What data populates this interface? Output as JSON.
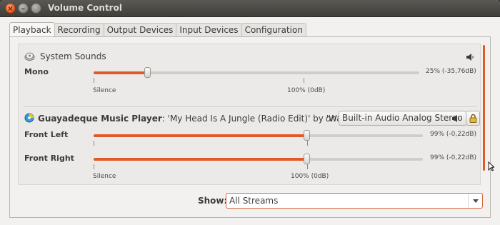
{
  "window": {
    "title": "Volume Control"
  },
  "tabs": [
    {
      "label": "Playback",
      "active": true
    },
    {
      "label": "Recording",
      "active": false
    },
    {
      "label": "Output Devices",
      "active": false
    },
    {
      "label": "Input Devices",
      "active": false
    },
    {
      "label": "Configuration",
      "active": false
    }
  ],
  "streams": {
    "system": {
      "name": "System Sounds",
      "icon": "system-sounds-icon",
      "channels": [
        {
          "label": "Mono",
          "level": 0.25,
          "readout": "25% (-35,76dB)"
        }
      ],
      "scale_labels": {
        "silence": "Silence",
        "full": "100% (0dB)"
      }
    },
    "player": {
      "app": "Guayadeque Music Player",
      "separator": ":",
      "description": "'My Head Is A Jungle (Radio Edit)' by 'Wankelmut'",
      "on_label": "on",
      "device": "Built-in Audio Analog Stereo",
      "channels": [
        {
          "label": "Front Left",
          "level": 0.99,
          "readout": "99% (-0,22dB)"
        },
        {
          "label": "Front Right",
          "level": 0.99,
          "readout": "99% (-0,22dB)"
        }
      ],
      "scale_labels": {
        "silence": "Silence",
        "full": "100% (0dB)"
      }
    }
  },
  "show": {
    "label": "Show:",
    "value": "All Streams"
  },
  "colors": {
    "accent": "#df5a24",
    "titlebar": "#3f3e3a",
    "background": "#f2f1f0"
  }
}
